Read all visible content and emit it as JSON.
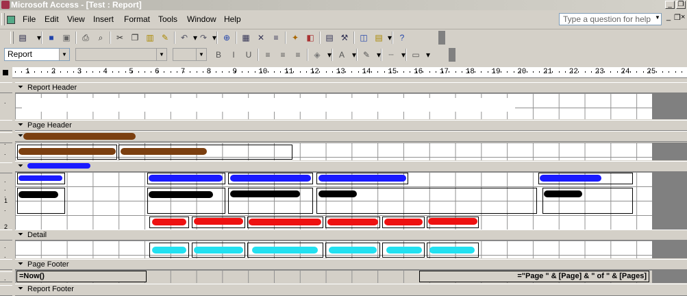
{
  "window": {
    "title": "Microsoft Access - [Test : Report]"
  },
  "menu": [
    "File",
    "Edit",
    "View",
    "Insert",
    "Format",
    "Tools",
    "Window",
    "Help"
  ],
  "help_box": {
    "placeholder": "Type a question for help"
  },
  "format_toolbar": {
    "object_combo": "Report",
    "font_combo": "",
    "size_combo": ""
  },
  "ruler": {
    "ticks": [
      "1",
      "2",
      "3",
      "4",
      "5",
      "6",
      "7",
      "8",
      "9",
      "10",
      "11",
      "12",
      "13",
      "14",
      "15",
      "16",
      "17",
      "18",
      "19",
      "20",
      "21",
      "22",
      "23",
      "24",
      "25"
    ]
  },
  "vruler_marks": [
    "1",
    "2"
  ],
  "sections": {
    "report_header": "Report Header",
    "page_header": "Page Header",
    "detail": "Detail",
    "page_footer": "Page Footer",
    "report_footer": "Report Footer"
  },
  "page_footer_controls": {
    "now": "=Now()",
    "pages": "=\"Page \" & [Page] & \" of \" & [Pages]"
  },
  "colors": {
    "brown_scribble": "#7b3f10",
    "blue_scribble": "#1a1aff",
    "black_scribble": "#000000",
    "red_scribble": "#ee1111",
    "cyan_scribble": "#22e0f0",
    "white_scribble": "#ffffff"
  },
  "icons": [
    "view-icon",
    "save-icon",
    "file-search-icon",
    "print-icon",
    "print-preview-icon",
    "spelling-icon",
    "cut-icon",
    "copy-icon",
    "paste-icon",
    "format-painter-icon",
    "undo-icon",
    "redo-icon",
    "hyperlink-icon",
    "field-list-icon",
    "toolbox-icon",
    "sorting-grouping-icon",
    "autoformat-icon",
    "code-icon",
    "properties-icon",
    "build-icon",
    "database-window-icon",
    "new-object-icon",
    "help-icon",
    "bold-icon",
    "italic-icon",
    "underline-icon",
    "align-left-icon",
    "align-center-icon",
    "align-right-icon",
    "fill-color-icon",
    "font-color-icon",
    "line-color-icon",
    "line-width-icon",
    "special-effect-icon"
  ]
}
